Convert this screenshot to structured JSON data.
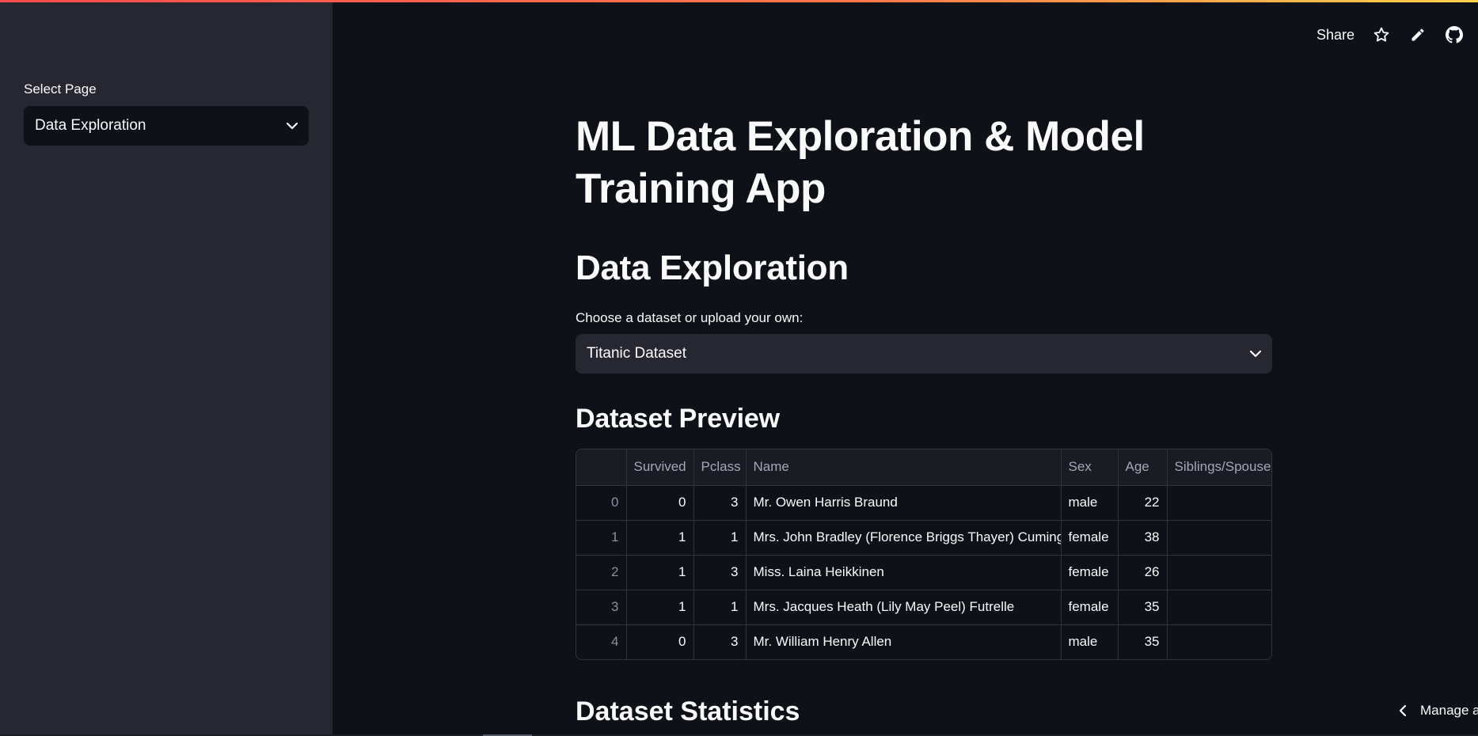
{
  "sidebar": {
    "label": "Select Page",
    "selected": "Data Exploration"
  },
  "toolbar": {
    "share_label": "Share",
    "icons": [
      "star-icon",
      "pencil-icon",
      "github-icon"
    ]
  },
  "main": {
    "title": "ML Data Exploration & Model Training App",
    "section_title": "Data Exploration",
    "dataset_label": "Choose a dataset or upload your own:",
    "dataset_selected": "Titanic Dataset",
    "preview_title": "Dataset Preview",
    "stats_title": "Dataset Statistics"
  },
  "table": {
    "columns": [
      "",
      "Survived",
      "Pclass",
      "Name",
      "Sex",
      "Age",
      "Siblings/Spouses"
    ],
    "rows": [
      [
        "0",
        "0",
        "3",
        "Mr. Owen Harris Braund",
        "male",
        "22",
        ""
      ],
      [
        "1",
        "1",
        "1",
        "Mrs. John Bradley (Florence Briggs Thayer) Cumings",
        "female",
        "38",
        ""
      ],
      [
        "2",
        "1",
        "3",
        "Miss. Laina Heikkinen",
        "female",
        "26",
        ""
      ],
      [
        "3",
        "1",
        "1",
        "Mrs. Jacques Heath (Lily May Peel) Futrelle",
        "female",
        "35",
        ""
      ],
      [
        "4",
        "0",
        "3",
        "Mr. William Henry Allen",
        "male",
        "35",
        ""
      ]
    ]
  },
  "footer": {
    "manage_label": "Manage app"
  },
  "colors": {
    "background": "#0e1117",
    "sidebar": "#262730",
    "accent": "#ff4b4b"
  }
}
